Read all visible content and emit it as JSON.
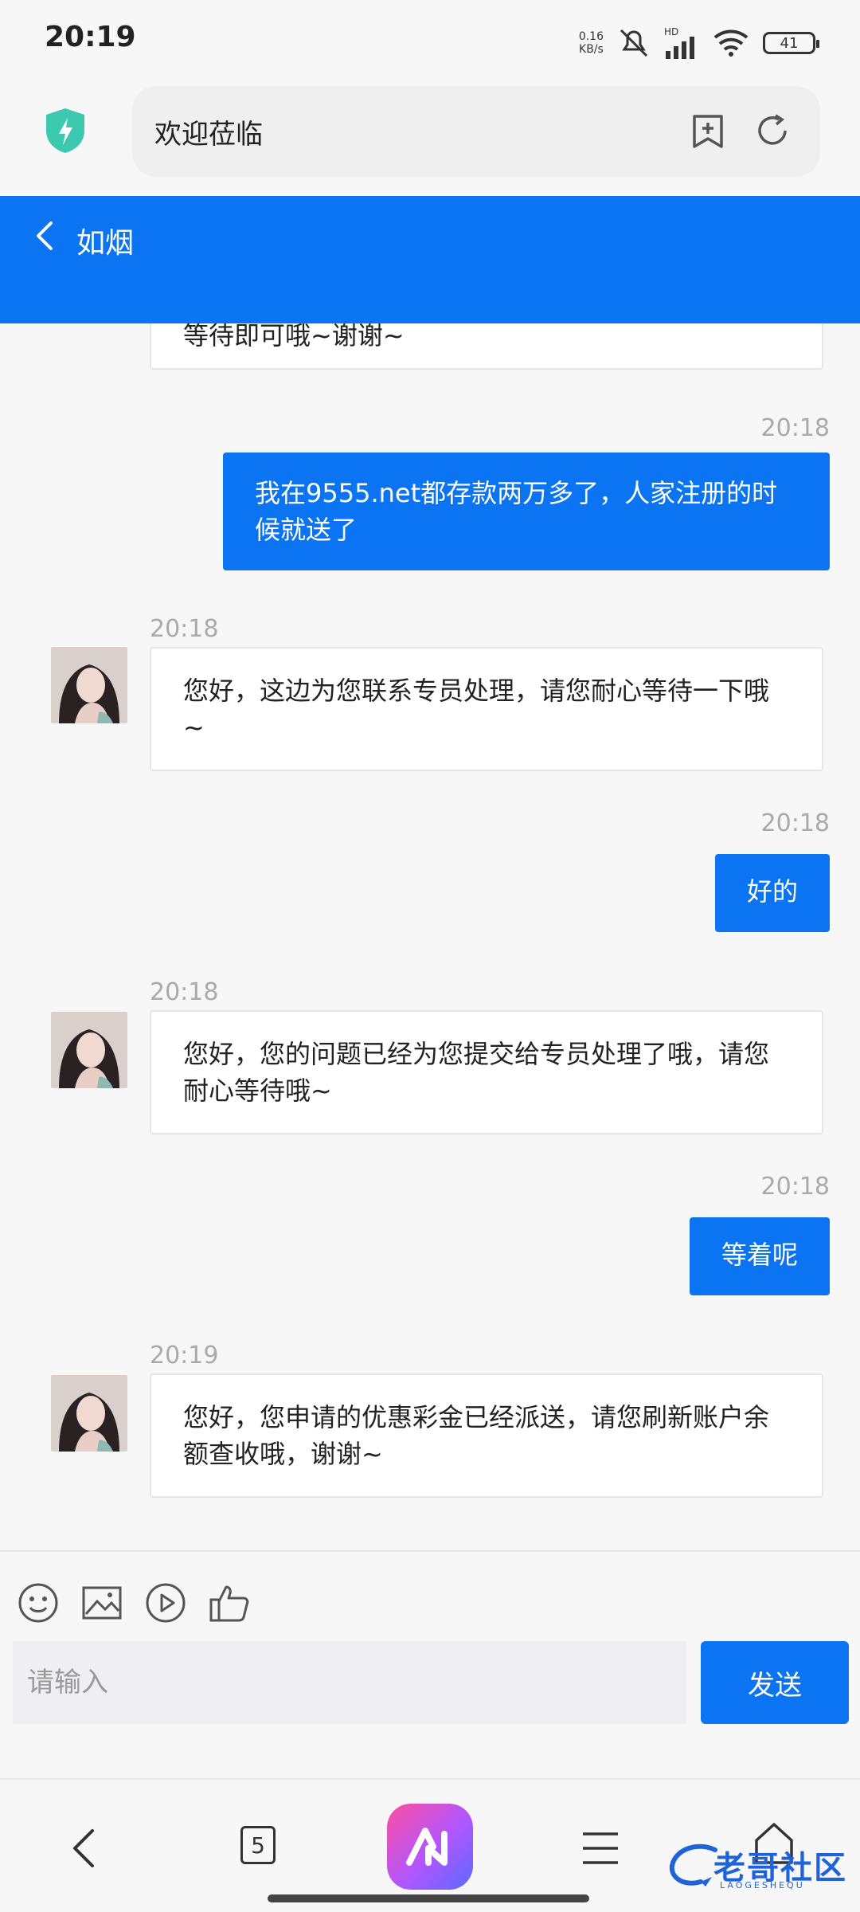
{
  "status_bar": {
    "time": "20:19",
    "net_speed_value": "0.16",
    "net_speed_unit": "KB/s",
    "network_label": "HD",
    "battery": "41"
  },
  "browser": {
    "address_text": "欢迎莅临"
  },
  "chat": {
    "title": "如烟",
    "messages": [
      {
        "side": "in",
        "time": "",
        "text": "等待即可哦~谢谢~"
      },
      {
        "side": "out",
        "time": "20:18",
        "text": "我在9555.net都存款两万多了，人家注册的时候就送了"
      },
      {
        "side": "in",
        "time": "20:18",
        "text": "您好，这边为您联系专员处理，请您耐心等待一下哦~"
      },
      {
        "side": "out",
        "time": "20:18",
        "text": "好的"
      },
      {
        "side": "in",
        "time": "20:18",
        "text": "您好，您的问题已经为您提交给专员处理了哦，请您耐心等待哦~"
      },
      {
        "side": "out",
        "time": "20:18",
        "text": "等着呢"
      },
      {
        "side": "in",
        "time": "20:19",
        "text": "您好，您申请的优惠彩金已经派送，请您刷新账户余额查收哦，谢谢~"
      }
    ]
  },
  "composer": {
    "placeholder": "请输入",
    "send_label": "发送",
    "tools": [
      "emoji-icon",
      "image-icon",
      "video-icon",
      "like-icon"
    ]
  },
  "bottom_nav": {
    "tabs_count": "5",
    "watermark_text": "老哥社区",
    "watermark_sub": "LAOGESHEQU"
  },
  "colors": {
    "accent": "#0a74f2",
    "background": "#f7f7f7"
  }
}
